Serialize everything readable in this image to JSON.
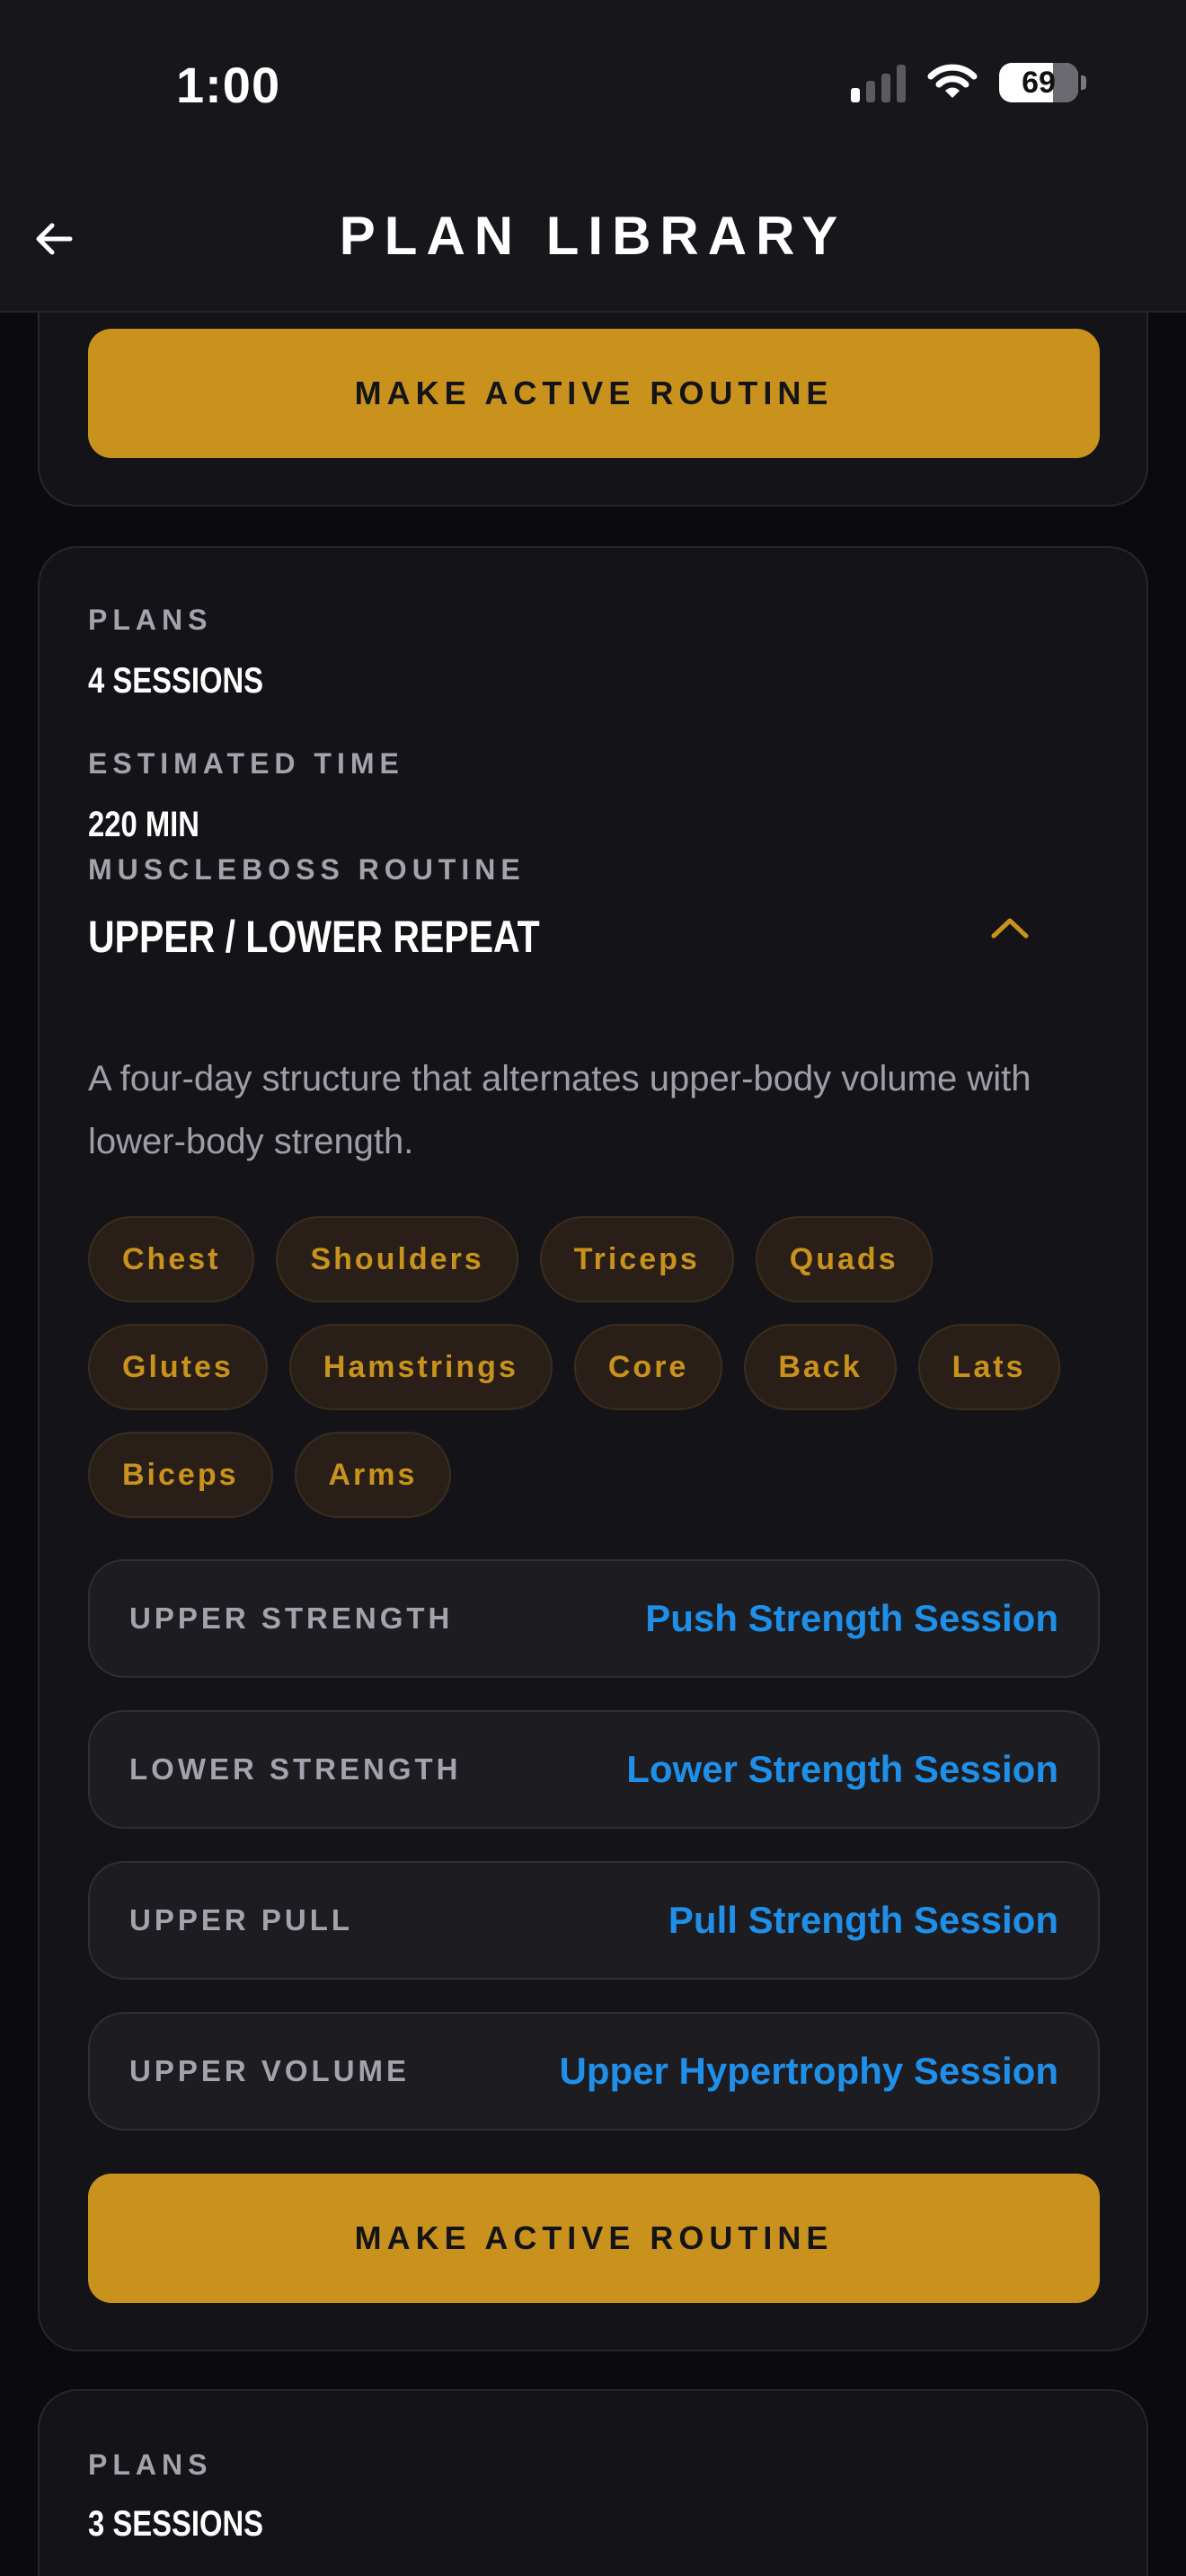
{
  "status_bar": {
    "time": "1:00",
    "battery": "69",
    "signal_icon": "cellular-signal-icon",
    "wifi_icon": "wifi-icon"
  },
  "header": {
    "title": "PLAN LIBRARY",
    "back_icon": "arrow-left-icon"
  },
  "top_card": {
    "button_label": "MAKE ACTIVE ROUTINE"
  },
  "routine_card": {
    "plans_label": "PLANS",
    "plans_value": "4 SESSIONS",
    "time_label": "ESTIMATED TIME",
    "time_value": "220 MIN",
    "kicker": "MUSCLEBOSS ROUTINE",
    "name": "UPPER / LOWER REPEAT",
    "expanded": true,
    "description": "A four-day structure that alternates upper-body volume with lower-body strength.",
    "tags": [
      "Chest",
      "Shoulders",
      "Triceps",
      "Quads",
      "Glutes",
      "Hamstrings",
      "Core",
      "Back",
      "Lats",
      "Biceps",
      "Arms"
    ],
    "sessions": [
      {
        "label": "UPPER STRENGTH",
        "link": "Push Strength Session"
      },
      {
        "label": "LOWER STRENGTH",
        "link": "Lower Strength Session"
      },
      {
        "label": "UPPER PULL",
        "link": "Pull Strength Session"
      },
      {
        "label": "UPPER VOLUME",
        "link": "Upper Hypertrophy Session"
      }
    ],
    "button_label": "MAKE ACTIVE ROUTINE"
  },
  "next_card": {
    "plans_label": "PLANS",
    "plans_value": "3 SESSIONS"
  },
  "colors": {
    "accent": "#c8921c",
    "link": "#1f8fe8",
    "background": "#0b0b0d",
    "card": "#141418"
  }
}
